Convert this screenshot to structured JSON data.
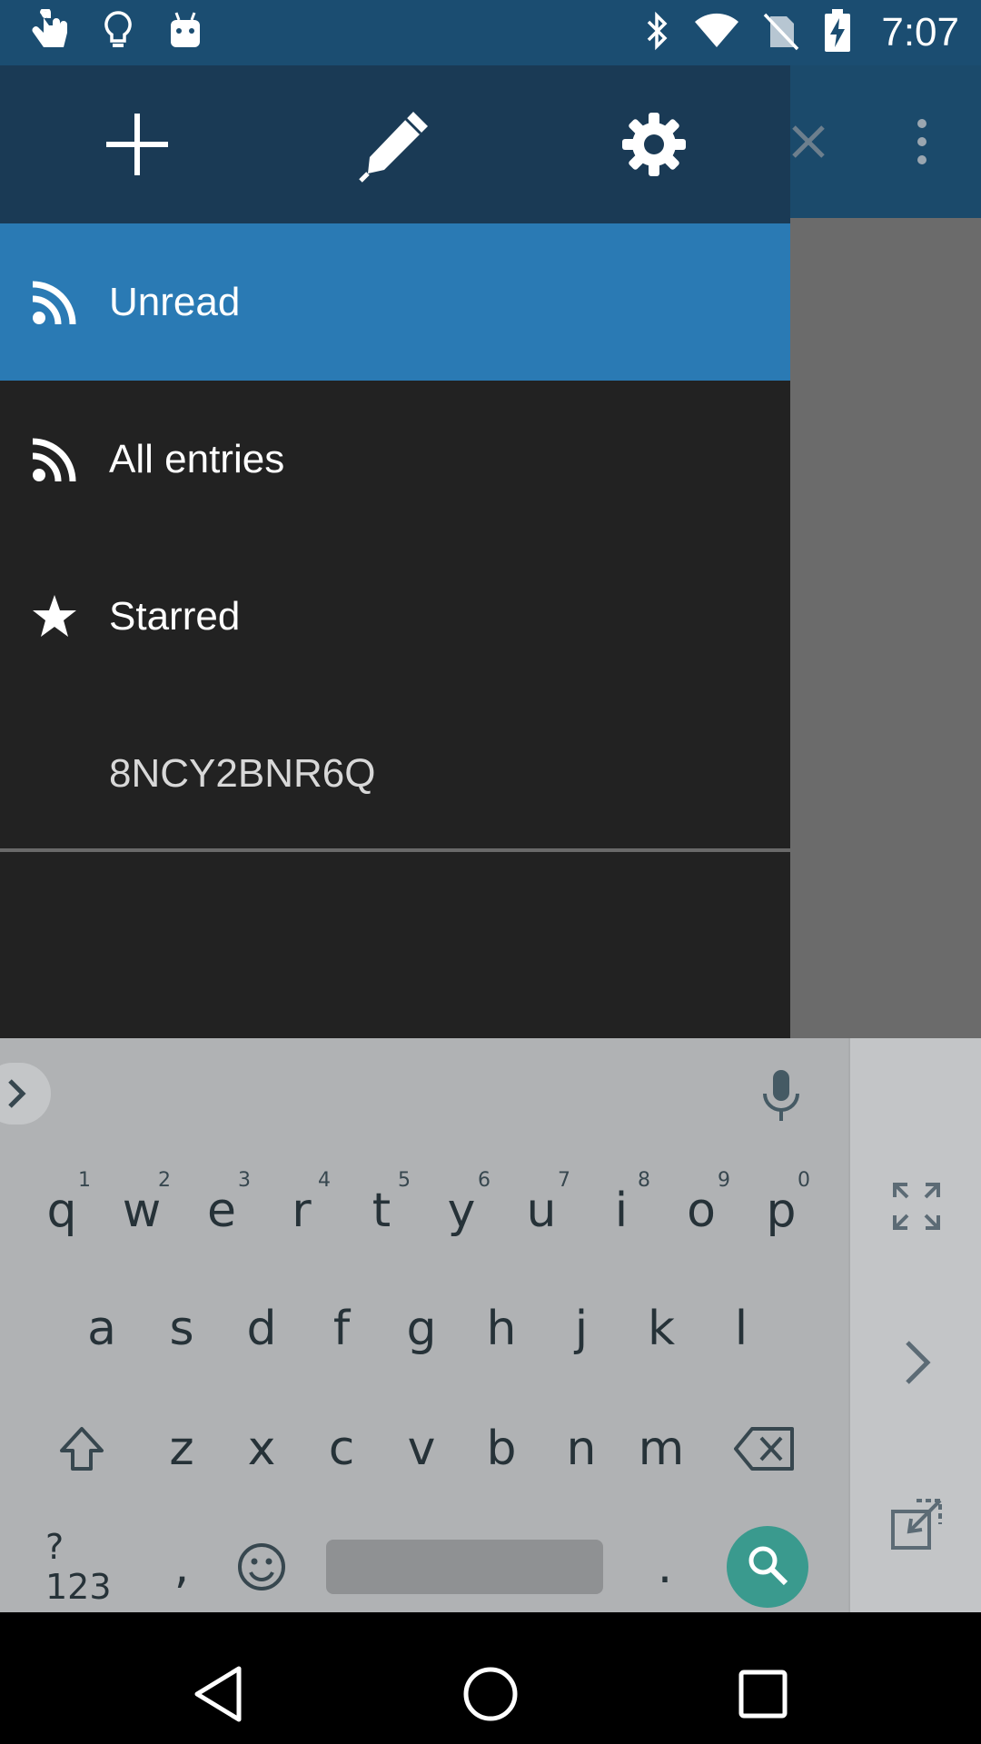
{
  "status_bar": {
    "time": "7:07",
    "left_icons": [
      "hand-pointer-icon",
      "lightbulb-icon",
      "android-icon"
    ],
    "right_icons": [
      "bluetooth-icon",
      "wifi-icon",
      "no-sim-icon",
      "battery-charging-icon"
    ]
  },
  "drawer": {
    "header_actions": [
      "add-icon",
      "edit-icon",
      "settings-icon"
    ],
    "items": [
      {
        "label": "Unread",
        "icon": "rss-icon",
        "active": true
      },
      {
        "label": "All entries",
        "icon": "rss-icon",
        "active": false
      },
      {
        "label": "Starred",
        "icon": "star-icon",
        "active": false
      },
      {
        "label": "8NCY2BNR6Q",
        "icon": "",
        "active": false
      }
    ]
  },
  "colors": {
    "status_bar": "#1b4d71",
    "drawer_header": "#1a3a55",
    "active_item": "#2a7ab4",
    "drawer_bg": "#222222",
    "search_key": "#3a9a8e"
  },
  "keyboard": {
    "row1": [
      "q",
      "w",
      "e",
      "r",
      "t",
      "y",
      "u",
      "i",
      "o",
      "p"
    ],
    "row1_hints": [
      "1",
      "2",
      "3",
      "4",
      "5",
      "6",
      "7",
      "8",
      "9",
      "0"
    ],
    "row2": [
      "a",
      "s",
      "d",
      "f",
      "g",
      "h",
      "j",
      "k",
      "l"
    ],
    "row3": [
      "z",
      "x",
      "c",
      "v",
      "b",
      "n",
      "m"
    ],
    "symbols_key": "?123",
    "comma_key": ",",
    "period_key": "."
  }
}
